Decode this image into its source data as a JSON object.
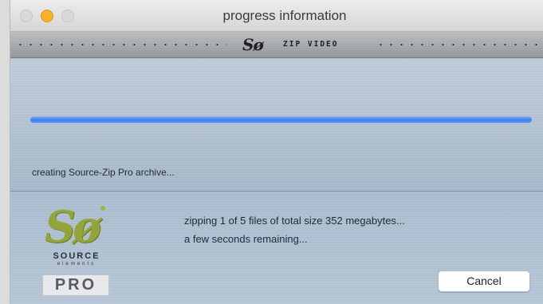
{
  "window": {
    "title": "progress information"
  },
  "branding": {
    "logo_text": "Sø",
    "product_text": "ZIP VIDEO"
  },
  "progress": {
    "fraction": 1.0,
    "status_text": "creating Source-Zip Pro archive..."
  },
  "details": {
    "line1": "zipping 1 of 5 files of total size 352 megabytes...",
    "line2": "a few seconds remaining..."
  },
  "logo": {
    "mark": "Sø",
    "source": "SOURCE",
    "elements": "elements",
    "pro": "PRO"
  },
  "buttons": {
    "cancel_label": "Cancel"
  },
  "colors": {
    "progress_fill": "#3f7ff0",
    "logo_green": "#93a53a",
    "minimize_button": "#f6b126"
  }
}
